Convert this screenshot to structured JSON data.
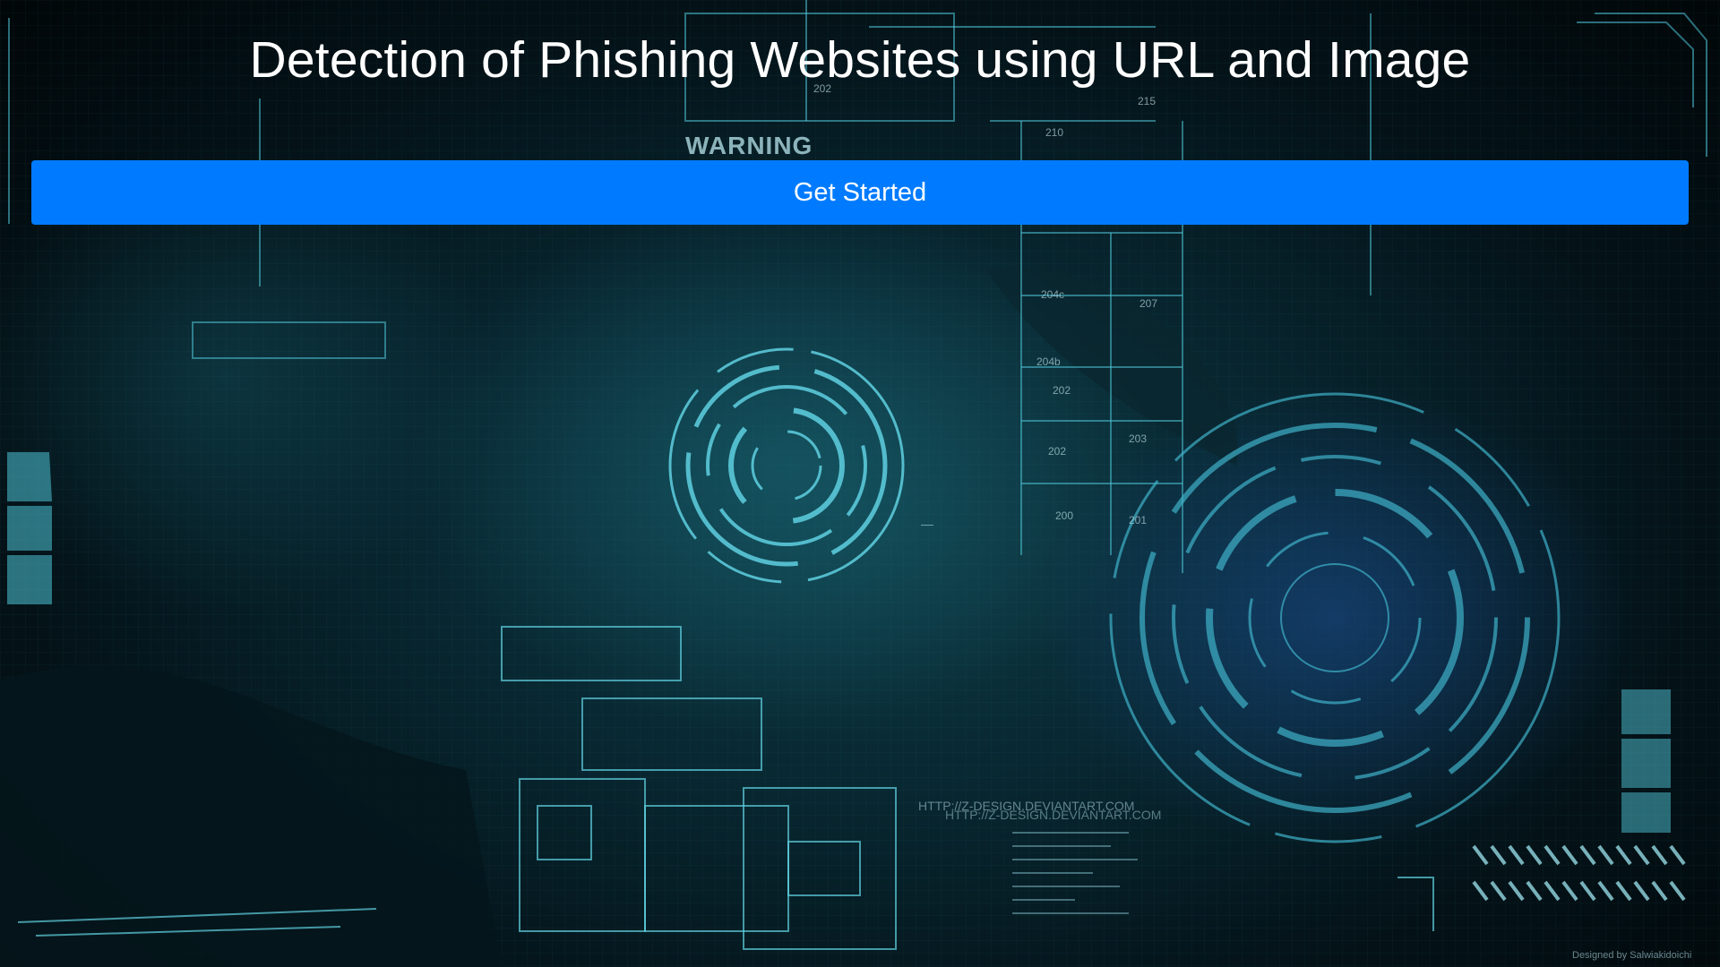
{
  "header": {
    "title": "Detection of Phishing Websites using URL and Image"
  },
  "actions": {
    "get_started_label": "Get Started"
  },
  "background": {
    "theme": "cyber-blueprint",
    "stencil_text": "WARNING",
    "room_labels": [
      "202",
      "215",
      "210",
      "204c",
      "207",
      "204b",
      "202",
      "203",
      "202",
      "200",
      "201"
    ],
    "url_text": "HTTP://Z-DESIGN.DEVIANTART.COM",
    "credit_text": "Designed by Salwiakidoichi",
    "colors": {
      "accent_cyan": "#4fc3d6",
      "deep_teal": "#0d3a44",
      "button_blue": "#007bff"
    }
  }
}
